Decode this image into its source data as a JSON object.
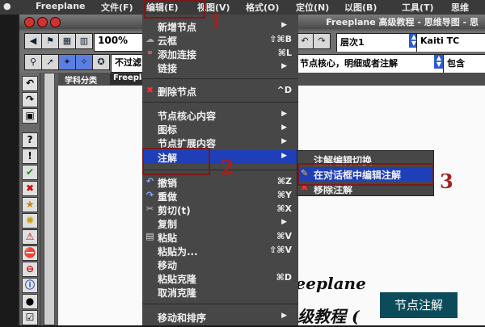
{
  "menubar": {
    "items": [
      "Freeplane",
      "文件(F)",
      "编辑(E)",
      "视图(V)",
      "格式(O)",
      "定位(N)",
      "以图(B)",
      "工具(T)",
      "思维"
    ]
  },
  "window": {
    "title": "Freeplane 高级教程 - 思维导图 - 思"
  },
  "toolbar": {
    "zoom": "100%",
    "level": "层次1",
    "font": "Kaiti TC",
    "filter": "不过滤",
    "search_value": "节点核心，明细或者注解",
    "match_option": "包含"
  },
  "tabs": [
    "学科分类",
    "Freeplane"
  ],
  "canvas": {
    "brand_line1": "reeplane",
    "brand_line2": "级教程 (",
    "note_box": "节点注解"
  },
  "edit_menu": {
    "items": [
      {
        "label": "新增节点",
        "shortcut": "",
        "arrow": "▶",
        "icon": ""
      },
      {
        "label": "云框",
        "shortcut": "⇧⌘B",
        "arrow": "",
        "icon": "☁"
      },
      {
        "label": "添加连接",
        "shortcut": "⌘L",
        "arrow": "",
        "icon": "⚭"
      },
      {
        "label": "链接",
        "shortcut": "",
        "arrow": "▶",
        "icon": ""
      },
      {
        "label": "删除节点",
        "shortcut": "^D",
        "arrow": "",
        "icon": "✖"
      },
      {
        "label": "节点核心内容",
        "shortcut": "",
        "arrow": "▶",
        "icon": ""
      },
      {
        "label": "图标",
        "shortcut": "",
        "arrow": "▶",
        "icon": ""
      },
      {
        "label": "节点扩展内容",
        "shortcut": "",
        "arrow": "▶",
        "icon": ""
      },
      {
        "label": "注解",
        "shortcut": "",
        "arrow": "▶",
        "icon": ""
      },
      {
        "label": "撤销",
        "shortcut": "⌘Z",
        "arrow": "",
        "icon": "↶"
      },
      {
        "label": "重做",
        "shortcut": "⌘Y",
        "arrow": "",
        "icon": "↷"
      },
      {
        "label": "剪切(t)",
        "shortcut": "⌘X",
        "arrow": "",
        "icon": "✂"
      },
      {
        "label": "复制",
        "shortcut": "",
        "arrow": "▶",
        "icon": ""
      },
      {
        "label": "粘贴",
        "shortcut": "⌘V",
        "arrow": "",
        "icon": "▤"
      },
      {
        "label": "粘贴为...",
        "shortcut": "⇧⌘V",
        "arrow": "",
        "icon": ""
      },
      {
        "label": "移动",
        "shortcut": "",
        "arrow": "",
        "icon": ""
      },
      {
        "label": "粘贴克隆",
        "shortcut": "⌘D",
        "arrow": "",
        "icon": ""
      },
      {
        "label": "取消克隆",
        "shortcut": "",
        "arrow": "",
        "icon": ""
      },
      {
        "label": "移动和排序",
        "shortcut": "",
        "arrow": "▶",
        "icon": ""
      }
    ]
  },
  "notes_submenu": {
    "items": [
      {
        "label": "注解编辑切换",
        "icon": ""
      },
      {
        "label": "在对话框中编辑注解",
        "icon": "✎"
      },
      {
        "label": "移除注解",
        "icon": "✖"
      }
    ]
  },
  "steps": [
    "1",
    "2",
    "3"
  ],
  "colors": {
    "highlight": "#1f3fb8",
    "annotation_red": "#a52020",
    "note_box": "#0c4c5a"
  }
}
